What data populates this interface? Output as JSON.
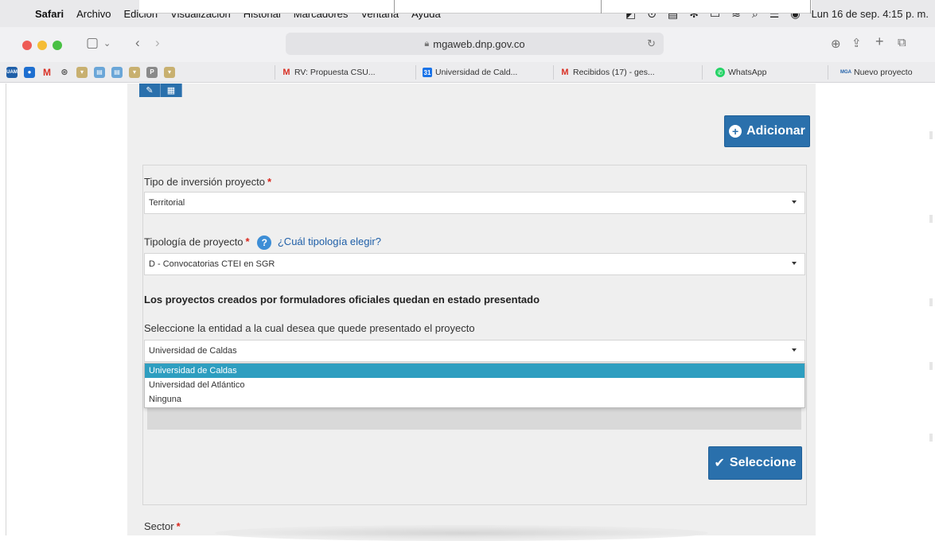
{
  "menubar": {
    "app": "Safari",
    "items": [
      "Archivo",
      "Edición",
      "Visualización",
      "Historial",
      "Marcadores",
      "Ventana",
      "Ayuda"
    ],
    "datetime": "Lun 16 de sep.  4:15 p. m."
  },
  "toolbar": {
    "url": "mgaweb.dnp.gov.co"
  },
  "favorites": {
    "tabs": [
      {
        "label": "RV: Propuesta CSU...",
        "icon": "gmail-icon",
        "color": "#d93025"
      },
      {
        "label": "Universidad de Cald...",
        "icon": "calendar-icon",
        "color": "#1a73e8"
      },
      {
        "label": "Recibidos (17) - ges...",
        "icon": "gmail-icon",
        "color": "#d93025"
      },
      {
        "label": "WhatsApp",
        "icon": "whatsapp-icon",
        "color": "#25d366"
      },
      {
        "label": "Nuevo proyecto",
        "icon": "mga-icon",
        "color": "#1f5fa8"
      }
    ],
    "mini_badges": [
      "UAM",
      "M",
      "P"
    ]
  },
  "page": {
    "adicionar_label": "Adicionar",
    "tipo_inversion_label": "Tipo de inversión proyecto",
    "tipo_inversion_value": "Territorial",
    "tipologia_label": "Tipología de proyecto",
    "tipologia_help_link": "¿Cuál tipología elegir?",
    "tipologia_value": "D - Convocatorias CTEI en SGR",
    "notice": "Los proyectos creados por formuladores oficiales quedan en estado presentado",
    "entidad_label": "Seleccione la entidad a la cual desea que quede presentado el proyecto",
    "entidad_value": "Universidad de Caldas",
    "entidad_options": [
      "Universidad de Caldas",
      "Universidad del Atlántico",
      "Ninguna"
    ],
    "seleccione_label": "Seleccione",
    "sector_label": "Sector",
    "required_mark": "*"
  },
  "colors": {
    "primary_button": "#2a70ac",
    "selected_option": "#2e9ec0",
    "required": "#d9261c"
  }
}
